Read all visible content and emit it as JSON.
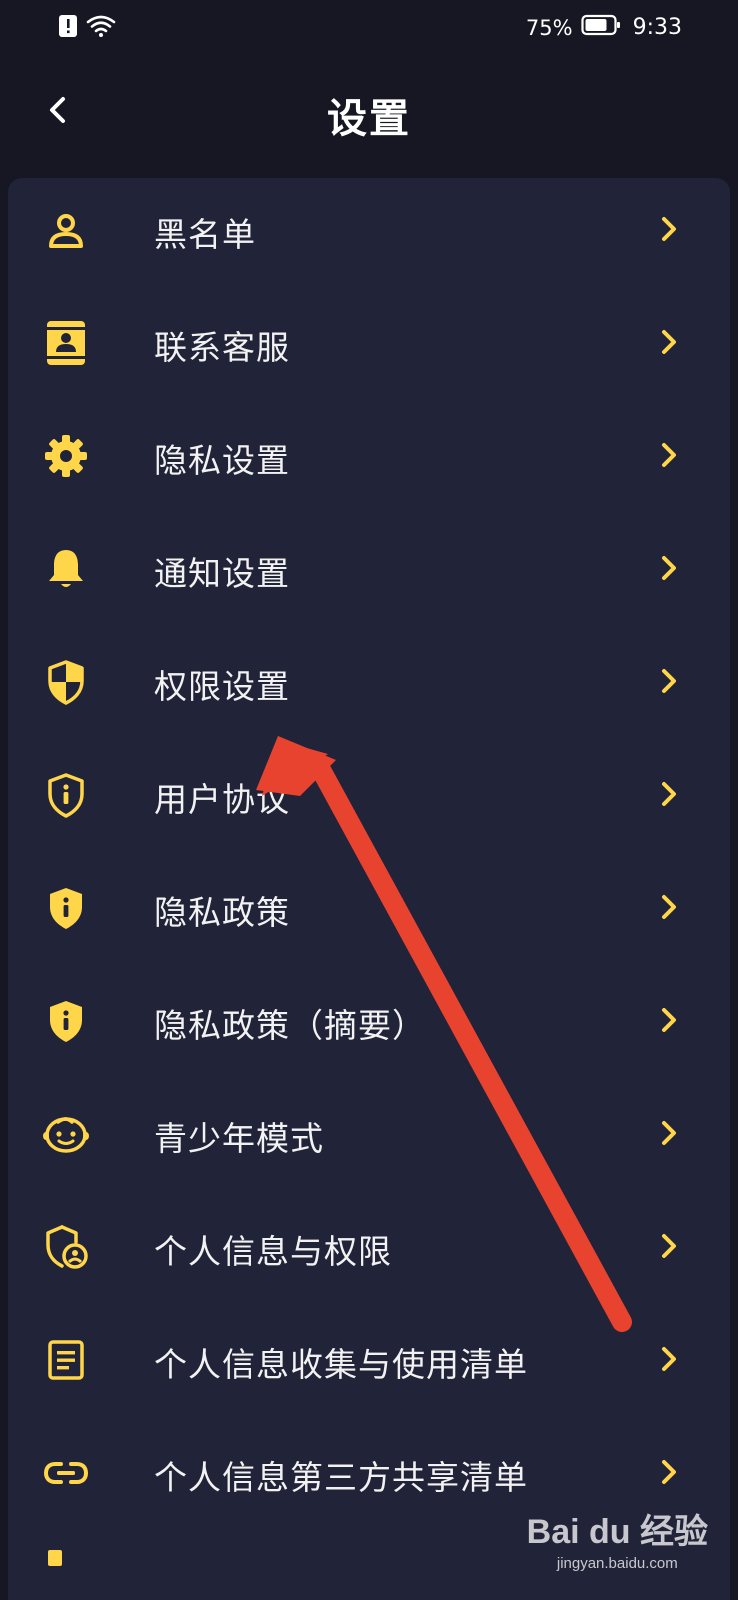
{
  "status_bar": {
    "battery_percent": "75%",
    "time": "9:33",
    "icons": [
      "alert-icon",
      "wifi-icon",
      "battery-icon"
    ]
  },
  "header": {
    "back_icon": "chevron-left-icon",
    "title": "设置"
  },
  "theme": {
    "background": "#161722",
    "card": "#212338",
    "accent_yellow": "#FFD54A",
    "arrow_red": "#E8432F"
  },
  "settings": {
    "items": [
      {
        "label": "黑名单",
        "icon": "person-icon"
      },
      {
        "label": "联系客服",
        "icon": "contact-card-icon"
      },
      {
        "label": "隐私设置",
        "icon": "gear-icon"
      },
      {
        "label": "通知设置",
        "icon": "bell-icon"
      },
      {
        "label": "权限设置",
        "icon": "shield-half-icon"
      },
      {
        "label": "用户协议",
        "icon": "shield-info-outline-icon"
      },
      {
        "label": "隐私政策",
        "icon": "shield-info-icon"
      },
      {
        "label": "隐私政策（摘要）",
        "icon": "shield-info-icon"
      },
      {
        "label": "青少年模式",
        "icon": "child-face-icon"
      },
      {
        "label": "个人信息与权限",
        "icon": "shield-person-icon"
      },
      {
        "label": "个人信息收集与使用清单",
        "icon": "document-list-icon"
      },
      {
        "label": "个人信息第三方共享清单",
        "icon": "link-icon"
      }
    ]
  },
  "watermark": {
    "logo": "Bai du 经验",
    "url": "jingyan.baidu.com"
  }
}
